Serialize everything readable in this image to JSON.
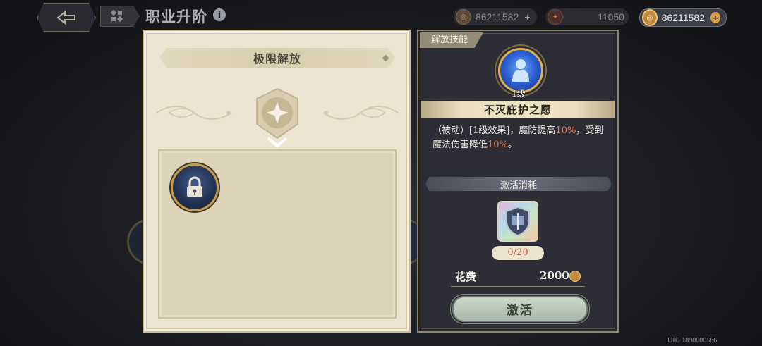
{
  "header": {
    "title": "职业升阶",
    "info_icon": "info-icon",
    "back_icon": "back-arrow-icon",
    "menu_icon": "grid-menu-icon"
  },
  "currencies": [
    {
      "icon": "gold-coin-icon",
      "value": "86211582",
      "plus": "+"
    },
    {
      "icon": "star-shard-icon",
      "value": "11050"
    },
    {
      "icon": "gold-coin-icon",
      "value": "86211582",
      "plus": "+"
    }
  ],
  "left_panel": {
    "title": "极限解放",
    "emblem_icon": "star-emblem-icon",
    "expand_icon": "chevron-down-icon",
    "slots": [
      {
        "icon": "lock-icon",
        "locked": true
      }
    ]
  },
  "right_panel": {
    "tag": "解放技能",
    "skill": {
      "icon": "guardian-figure-icon",
      "level": "1级",
      "name": "不灭庇护之愿",
      "desc_parts": [
        {
          "text": "（被动）[1级效果]，魔防提高",
          "hl": false
        },
        {
          "text": "10%",
          "hl": true
        },
        {
          "text": "，受到魔法伤害降低",
          "hl": false
        },
        {
          "text": "10%",
          "hl": true
        },
        {
          "text": "。",
          "hl": false
        }
      ]
    },
    "cost_title": "激活消耗",
    "cost_item": {
      "icon": "shield-badge-icon",
      "count": "0/20"
    },
    "price_label": "花费",
    "price_value": "2000",
    "price_icon": "gold-coin-icon",
    "activate_label": "激活"
  },
  "footer": {
    "uid": "UID 1890000586"
  },
  "colors": {
    "highlight": "#f07b52",
    "parchment": "#ece5d2",
    "panel_dark": "#2c2d35"
  }
}
